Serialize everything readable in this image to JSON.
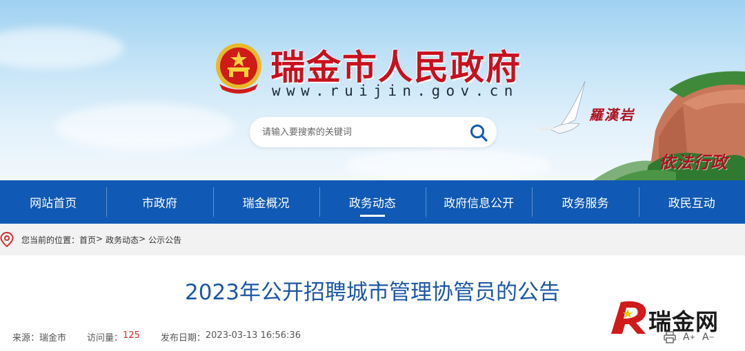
{
  "header": {
    "site_title": "瑞金市人民政府",
    "site_url": "www.ruijin.gov.cn",
    "emblem_icon": "national-emblem-icon",
    "search": {
      "placeholder": "请输入要搜索的关键词",
      "icon": "search-icon"
    },
    "scenery_caption_1": "羅漢岩",
    "scenery_caption_2": "依法行政"
  },
  "nav": {
    "items": [
      {
        "label": "网站首页"
      },
      {
        "label": "市政府"
      },
      {
        "label": "瑞金概况"
      },
      {
        "label": "政务动态",
        "active": true
      },
      {
        "label": "政府信息公开"
      },
      {
        "label": "政务服务"
      },
      {
        "label": "政民互动"
      }
    ]
  },
  "breadcrumb": {
    "prefix": "您当前的位置：",
    "items": [
      "首页",
      "政务动态",
      "公示公告"
    ],
    "separator": ">"
  },
  "article": {
    "title": "2023年公开招聘城市管理协管员的公告",
    "source_label": "来源：",
    "source_value": "瑞金市",
    "views_label": "访问量：",
    "views_value": "125",
    "published_label": "发布日期：",
    "published_value": "2023-03-13 16:56:36"
  },
  "watermark": {
    "text": "瑞金网"
  },
  "tools": {
    "print_icon": "print-icon",
    "font_larger": "A",
    "font_smaller": "A"
  },
  "colors": {
    "nav_bg": "#1059b4",
    "title_red": "#c8101e",
    "article_title": "#1b56a6",
    "views_red": "#d62b2b"
  }
}
